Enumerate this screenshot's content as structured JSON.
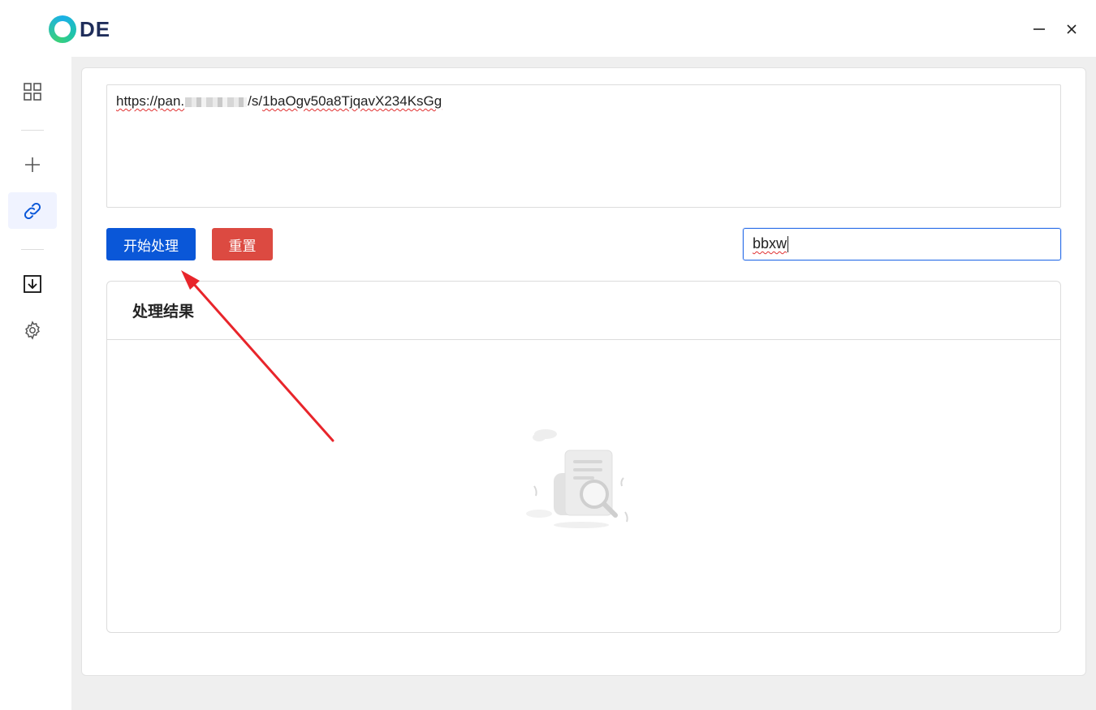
{
  "app": {
    "logo_text": "DE",
    "window_controls": {
      "minimize": "—",
      "close": "✕"
    }
  },
  "sidebar": {
    "items": [
      {
        "icon": "grid-icon",
        "active": false
      },
      {
        "icon": "plus-icon",
        "active": false
      },
      {
        "icon": "link-icon",
        "active": true
      },
      {
        "icon": "download-icon",
        "active": false
      },
      {
        "icon": "gear-icon",
        "active": false
      }
    ]
  },
  "form": {
    "url_prefix": "https://",
    "url_host": "pan.",
    "url_path": "/s/",
    "url_code": "1baOgv50a8TjqavX234KsGg",
    "start_button": "开始处理",
    "reset_button": "重置",
    "keyword_value": "bbxw"
  },
  "result": {
    "title": "处理结果"
  },
  "colors": {
    "primary": "#0a57d8",
    "danger": "#dc4a41",
    "annotation_arrow": "#e8252b"
  }
}
